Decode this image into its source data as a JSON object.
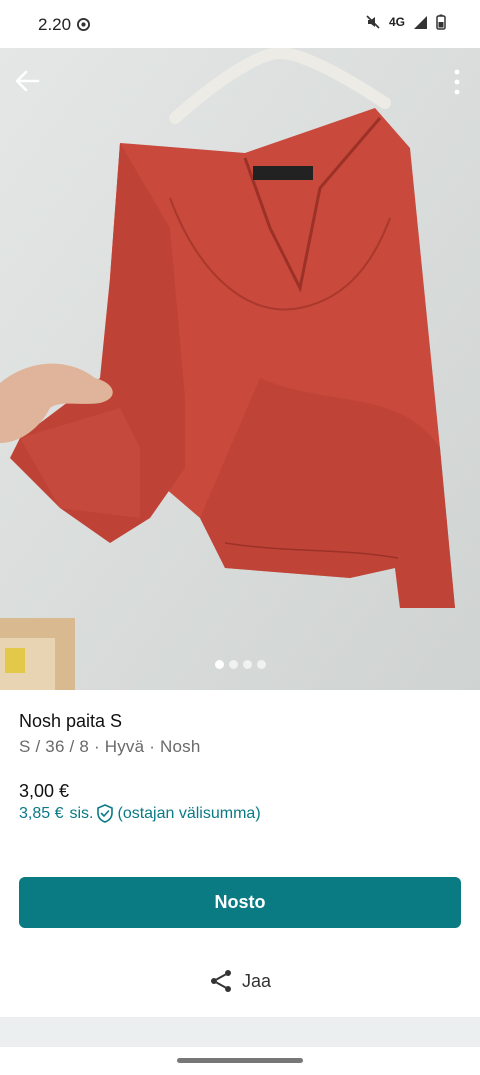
{
  "status_bar": {
    "time": "2.20",
    "network": "4G",
    "icons": [
      "chrome-icon",
      "mute-icon",
      "signal-icon",
      "battery-icon"
    ]
  },
  "photo": {
    "description_icons": [
      "back-arrow-icon",
      "more-vert-icon"
    ],
    "page_count": 4,
    "active_page": 1
  },
  "item": {
    "title": "Nosh paita S",
    "meta": "S / 36 / 8 · Hyvä · Nosh",
    "price": "3,00 €",
    "buyer_price": "3,85 €",
    "buyer_price_suffix": "sis.",
    "buyer_protection": "(ostajan välisumma)"
  },
  "actions": {
    "buy_label": "Nosto",
    "share_label": "Jaa"
  },
  "colors": {
    "accent": "#0a7a83",
    "accent_text": "#0a7a86",
    "shirt": "#c9493c"
  }
}
